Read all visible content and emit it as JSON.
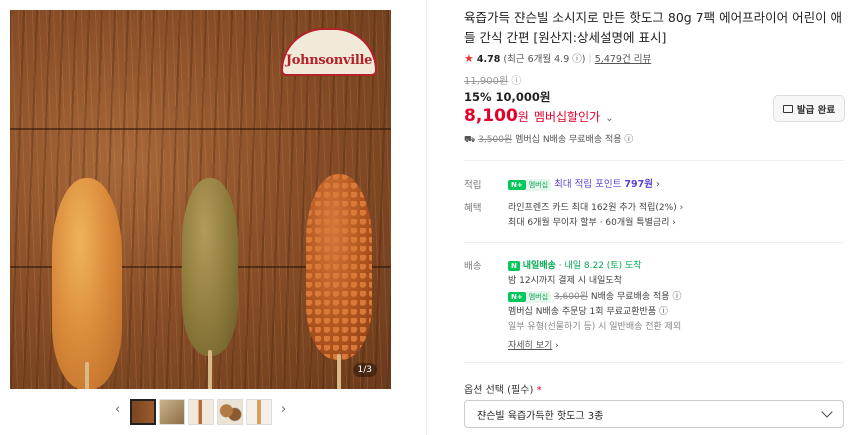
{
  "gallery": {
    "logo_text": "Johnsonville",
    "counter": "1/3",
    "prev_arrow": "‹",
    "next_arrow": "›",
    "thumbnails": [
      "thumb-1",
      "thumb-2",
      "thumb-3",
      "thumb-4",
      "thumb-5"
    ]
  },
  "product": {
    "title": "육즙가득 쟌슨빌 소시지로 만든 핫도그 80g 7팩 에어프라이어 어린이 애들 간식 간편 [원산지:상세설명에 표시]",
    "rating": "4.78",
    "rating_recent": "(최근 6개월 4.9",
    "review_count": "5,479건 리뷰",
    "original_price": "11,900원",
    "discount_rate": "15%",
    "sale_price": "10,000원",
    "member_price_value": "8,100",
    "member_price_unit": "원",
    "member_price_label": "멤버십할인가",
    "coupon_button": "발급 완료",
    "shipping_old": "3,500원",
    "shipping_text": "멤버십 N배송 무료배송 적용"
  },
  "points": {
    "label": "적립",
    "npay": "N+",
    "npay_sub": "멤버십",
    "text": "최대 적립 포인트",
    "value": "797원"
  },
  "benefits": {
    "label": "혜택",
    "line1": "라인프렌즈 카드 최대 162원 추가 적립(2%)",
    "line2": "최대 6개월 무이자 할부 · 60개월 특별금리"
  },
  "delivery": {
    "label": "배송",
    "badge": "내일배송",
    "arrival": "· 내일 8.22 (토) 도착",
    "line1": "밤 12시까지 결제 시 내일도착",
    "npay": "N+",
    "npay_sub": "멤버십",
    "fee_old": "3,600원",
    "fee_text": "N배송 무료배송 적용",
    "line3": "멤버십 N배송 주문당 1회 무료교환반품",
    "line4": "일부 유형(선물하기 등) 시 일반배송 전환 제외",
    "details_link": "자세히 보기"
  },
  "option": {
    "label": "옵션 선택 (필수)",
    "required_mark": "*",
    "selected": "쟌슨빌 육즙가득한 핫도그 3종"
  },
  "colors": {
    "accent_red": "#e4002b",
    "npay_green": "#03c75a",
    "point_purple": "#5c3fd6"
  }
}
